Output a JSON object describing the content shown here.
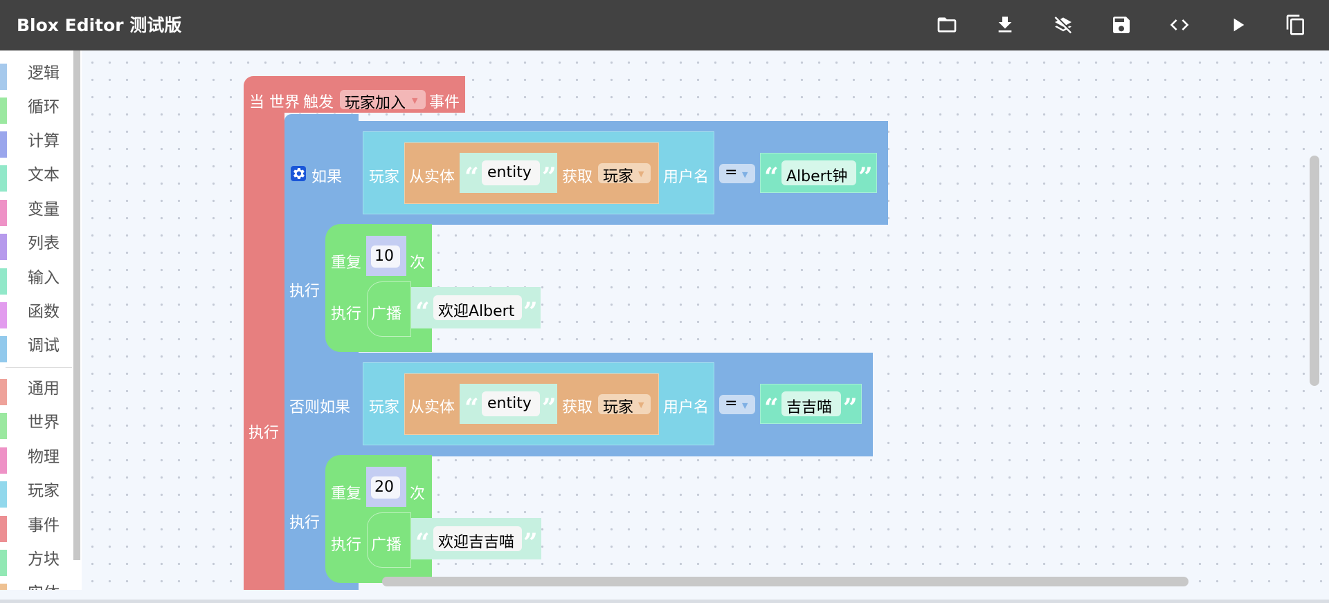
{
  "app": {
    "title": "Blox Editor 测试版"
  },
  "toolbar": [
    {
      "name": "open-folder-button",
      "icon": "folder-icon"
    },
    {
      "name": "download-button",
      "icon": "download-icon"
    },
    {
      "name": "clear-layers-button",
      "icon": "layers-off-icon"
    },
    {
      "name": "save-button",
      "icon": "save-icon"
    },
    {
      "name": "code-button",
      "icon": "code-icon"
    },
    {
      "name": "run-button",
      "icon": "play-icon"
    },
    {
      "name": "copy-button",
      "icon": "copy-icon"
    }
  ],
  "sidebar": {
    "categories": [
      {
        "label": "逻辑",
        "color": "#a6c9ec"
      },
      {
        "label": "循环",
        "color": "#9be8a0"
      },
      {
        "label": "计算",
        "color": "#9aa6ec"
      },
      {
        "label": "文本",
        "color": "#92e8c9"
      },
      {
        "label": "变量",
        "color": "#ee92c6"
      },
      {
        "label": "列表",
        "color": "#b69aec"
      },
      {
        "label": "输入",
        "color": "#92e8c9"
      },
      {
        "label": "函数",
        "color": "#e29cee"
      },
      {
        "label": "调试",
        "color": "#92c9ec"
      },
      {
        "label": "通用",
        "color": "#eea29a"
      },
      {
        "label": "世界",
        "color": "#9be8a0"
      },
      {
        "label": "物理",
        "color": "#ee92c6"
      },
      {
        "label": "玩家",
        "color": "#92d8ec"
      },
      {
        "label": "事件",
        "color": "#ec8f93"
      },
      {
        "label": "方块",
        "color": "#92e8b4"
      },
      {
        "label": "实体",
        "color": "#eec192"
      }
    ]
  },
  "workspace": {
    "event_block": {
      "when": "当",
      "world": "世界",
      "trigger": "触发",
      "event": "玩家加入",
      "suffix": "事件",
      "do": "执行"
    },
    "if_block": {
      "if": "如果",
      "do1": "执行",
      "else_if": "否则如果",
      "do2": "执行"
    },
    "cond1": {
      "player": "玩家",
      "from_entity": "从实体",
      "entity": "entity",
      "get": "获取",
      "type": "玩家",
      "username": "用户名",
      "op": "=",
      "compare": "Albert钟"
    },
    "cond2": {
      "player": "玩家",
      "from_entity": "从实体",
      "entity": "entity",
      "get": "获取",
      "type": "玩家",
      "username": "用户名",
      "op": "=",
      "compare": "吉吉喵"
    },
    "repeat1": {
      "repeat": "重复",
      "times": "10",
      "unit": "次",
      "do": "执行",
      "broadcast": "广播",
      "message": "欢迎Albert"
    },
    "repeat2": {
      "repeat": "重复",
      "times": "20",
      "unit": "次",
      "do": "执行",
      "broadcast": "广播",
      "message": "欢迎吉吉喵"
    }
  }
}
